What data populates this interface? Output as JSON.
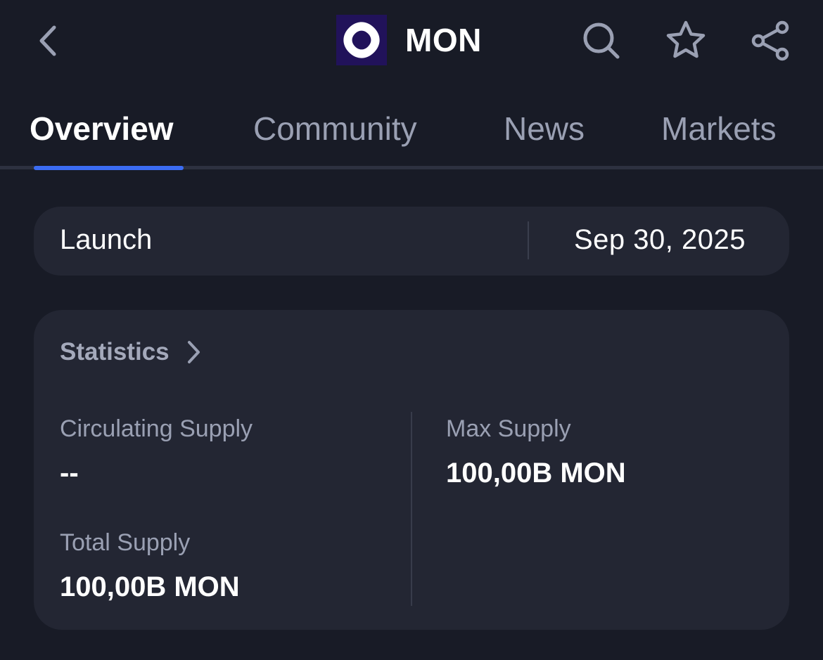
{
  "header": {
    "coin_name": "MON",
    "icons": {
      "back": "chevron-left-icon",
      "search": "search-icon",
      "favorite": "star-icon",
      "share": "share-icon"
    }
  },
  "tabs": [
    {
      "label": "Overview",
      "active": true
    },
    {
      "label": "Community",
      "active": false
    },
    {
      "label": "News",
      "active": false
    },
    {
      "label": "Markets",
      "active": false
    }
  ],
  "launch": {
    "label": "Launch",
    "date": "Sep 30, 2025"
  },
  "statistics": {
    "title": "Statistics",
    "circulating_supply": {
      "label": "Circulating Supply",
      "value": "--"
    },
    "total_supply": {
      "label": "Total Supply",
      "value": "100,00B MON"
    },
    "max_supply": {
      "label": "Max Supply",
      "value": "100,00B MON"
    }
  },
  "colors": {
    "background": "#181b26",
    "card": "#232633",
    "accent": "#3b6cf2",
    "logo_bg": "#21125a"
  }
}
